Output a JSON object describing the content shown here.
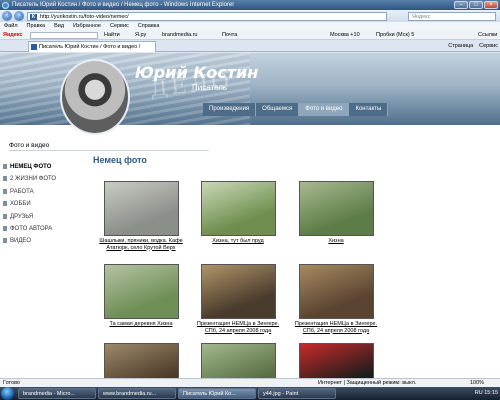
{
  "window": {
    "title": "Писатель Юрий Костин / Фото и видео / Немец фото - Windows Internet Explorer"
  },
  "address_bar": {
    "url": "http://yurikostin.ru/foto-video/nemec/",
    "search_placeholder": "Яндекс"
  },
  "menu": [
    "Файл",
    "Правка",
    "Вид",
    "Избранное",
    "Сервис",
    "Справка"
  ],
  "yandex_toolbar": {
    "logo": "Яндекс",
    "find_label": "Найти",
    "items": [
      "Я.ру",
      "brandmedia.ru",
      "Почта",
      "Москва +10",
      "Пробки (Мск) 5",
      "Ссылки"
    ]
  },
  "tabs": {
    "active_tab": "Писатель Юрий Костин / Фото и видео / Немец ф...",
    "tools": [
      "Страница",
      "Сервис"
    ]
  },
  "site": {
    "title": "Юрий Костин",
    "subtitle": "Писатель",
    "nav": [
      {
        "label": "Произведения",
        "active": false
      },
      {
        "label": "Общаемся",
        "active": false
      },
      {
        "label": "Фото и видео",
        "active": true
      },
      {
        "label": "Контакты",
        "active": false
      }
    ],
    "breadcrumb": "Фото и видео",
    "page_title": "Немец фото",
    "sidebar": [
      {
        "label": "НЕМЕЦ ФОТО",
        "active": true
      },
      {
        "label": "2 ЖИЗНИ ФОТО",
        "active": false
      },
      {
        "label": "РАБОТА",
        "active": false
      },
      {
        "label": "ХОББИ",
        "active": false
      },
      {
        "label": "ДРУЗЬЯ",
        "active": false
      },
      {
        "label": "ФОТО АВТОРА",
        "active": false
      },
      {
        "label": "ВИДЕО",
        "active": false
      }
    ],
    "photos": [
      {
        "caption": "Шашлыки, пряники, водка. Кафе Ататюрк, село Крутой Верх",
        "colors": [
          "#8b8f8a",
          "#c9ccc3"
        ]
      },
      {
        "caption": "Хизна, тут был пруд",
        "colors": [
          "#6f8e4e",
          "#c9d8b6"
        ]
      },
      {
        "caption": "Хизна",
        "colors": [
          "#5d7d48",
          "#a8b98f"
        ]
      },
      {
        "caption": "Та самая деревня Хизна",
        "colors": [
          "#6e8f56",
          "#b6c2a2"
        ]
      },
      {
        "caption": "Презентация НЕМЦа в Зингере. СПб, 24 апреля 2008 года",
        "colors": [
          "#4a3b2c",
          "#b0946a"
        ]
      },
      {
        "caption": "Презентация НЕМЦа в Зингере. СПб, 24 апреля 2008 года",
        "colors": [
          "#5a4330",
          "#a78b63"
        ]
      },
      {
        "caption": "",
        "colors": [
          "#4d3a2a",
          "#9d8a6a"
        ]
      },
      {
        "caption": "",
        "colors": [
          "#596f43",
          "#a2b98c"
        ]
      },
      {
        "caption": "",
        "colors": [
          "#1c1c1c",
          "#c92a2a"
        ]
      }
    ]
  },
  "status_bar": {
    "left": "Готово",
    "zone": "Интернет | Защищенный режим: выкл.",
    "zoom": "100%"
  },
  "taskbar": {
    "buttons": [
      "brandmedia - Micro...",
      "www.brandmedia.ru...",
      "Писатель Юрий Ко...",
      "y44.jpg - Paint"
    ],
    "active_index": 2,
    "clock": "15:15",
    "lang": "RU"
  }
}
